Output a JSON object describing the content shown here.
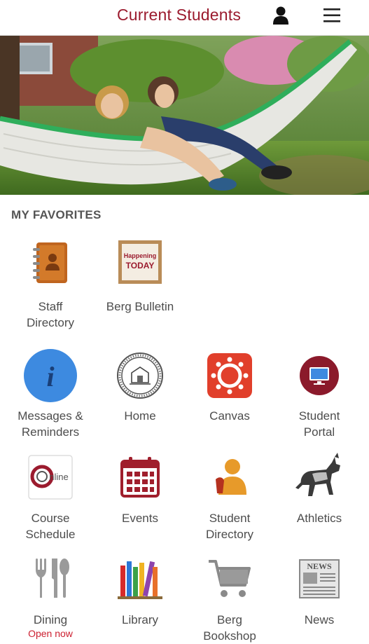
{
  "header": {
    "title": "Current Students",
    "user_icon": "user-icon",
    "menu_icon": "hamburger-menu-icon"
  },
  "hero": {
    "image": "students-in-hammock-photo"
  },
  "favorites": {
    "title": "MY FAVORITES",
    "items": [
      {
        "label": "Staff\nDirectory",
        "icon": "address-book-icon"
      },
      {
        "label": "Berg Bulletin",
        "icon": "bulletin-board-icon",
        "badge_line1": "Happening",
        "badge_line2": "TODAY"
      }
    ]
  },
  "apps": {
    "items": [
      {
        "label": "Messages &\nReminders",
        "icon": "info-icon"
      },
      {
        "label": "Home",
        "icon": "college-seal-icon"
      },
      {
        "label": "Canvas",
        "icon": "canvas-icon"
      },
      {
        "label": "Student\nPortal",
        "icon": "monitor-icon"
      },
      {
        "label": "Course\nSchedule",
        "icon": "online-logo-icon",
        "logo_text": "nline"
      },
      {
        "label": "Events",
        "icon": "calendar-icon"
      },
      {
        "label": "Student\nDirectory",
        "icon": "person-icon"
      },
      {
        "label": "Athletics",
        "icon": "mule-icon"
      },
      {
        "label": "Dining",
        "icon": "utensils-icon",
        "status": "Open now"
      },
      {
        "label": "Library",
        "icon": "books-icon"
      },
      {
        "label": "Berg\nBookshop",
        "icon": "shopping-cart-icon"
      },
      {
        "label": "News",
        "icon": "newspaper-icon",
        "logo_text": "NEWS"
      }
    ]
  },
  "colors": {
    "brand": "#9b1b2e",
    "label": "#4d4d4d",
    "info_blue": "#3d8ae0",
    "canvas_red": "#e13f2b",
    "status_red": "#cc1f2f"
  }
}
